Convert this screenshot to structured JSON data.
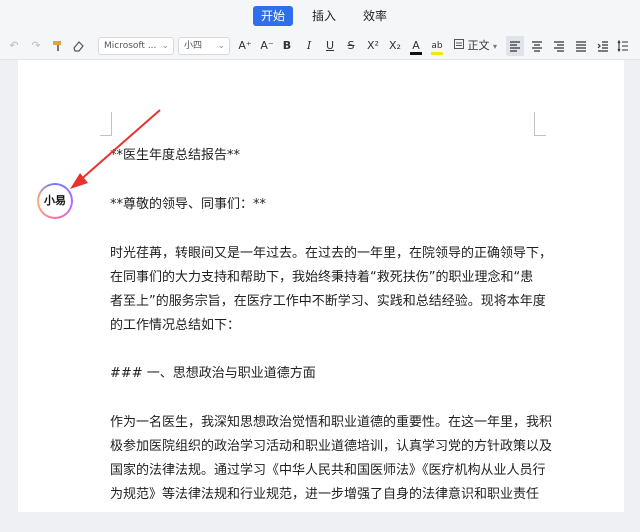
{
  "menu": {
    "tabs": [
      "开始",
      "插入",
      "效率"
    ],
    "active_index": 0
  },
  "toolbar": {
    "font_name": "Microsoft ...",
    "font_size": "小四",
    "grow_font": "A⁺",
    "shrink_font": "A⁻",
    "bold": "B",
    "italic": "I",
    "underline": "U",
    "strike": "S",
    "superscript": "X²",
    "subscript": "X₂",
    "font_color_glyph": "A",
    "highlight_glyph": "ab",
    "style_label": "正文",
    "colors": {
      "font_color": "#111111",
      "highlight": "#f5e21b"
    }
  },
  "avatar": {
    "label": "小易"
  },
  "document": {
    "lines": [
      "**医生年度总结报告**",
      "**尊敬的领导、同事们：**",
      "时光荏苒，转眼间又是一年过去。在过去的一年里，在院领导的正确领导下，",
      "在同事们的大力支持和帮助下，我始终秉持着“救死扶伤”的职业理念和“患",
      "者至上”的服务宗旨，在医疗工作中不断学习、实践和总结经验。现将本年度",
      "的工作情况总结如下：",
      "### 一、思想政治与职业道德方面",
      "作为一名医生，我深知思想政治觉悟和职业道德的重要性。在这一年里，我积",
      "极参加医院组织的政治学习活动和职业道德培训，认真学习党的方针政策以及",
      "国家的法律法规。通过学习《中华人民共和国医师法》《医疗机构从业人员行",
      "为规范》等法律法规和行业规范，进一步增强了自身的法律意识和职业责任"
    ]
  },
  "accent_color": "#2f6fec",
  "arrow_color": "#e8322e"
}
